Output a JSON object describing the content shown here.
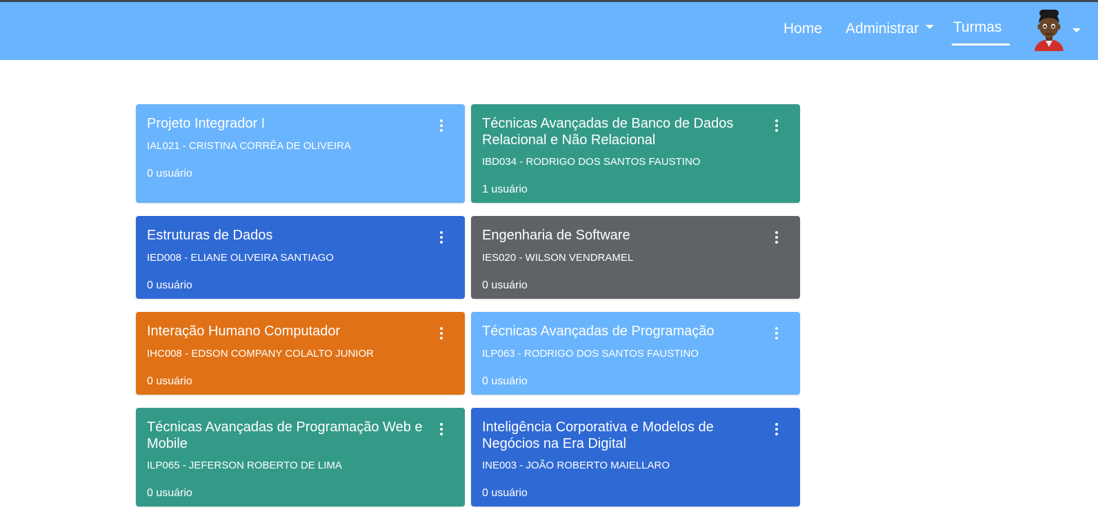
{
  "nav": {
    "home": "Home",
    "admin": "Administrar",
    "turmas": "Turmas"
  },
  "colors": {
    "navbar": "#6ab4fd",
    "light_blue": "#6ab4fd",
    "teal": "#349a88",
    "blue": "#2f69d4",
    "gray": "#5f6368",
    "orange": "#e07116"
  },
  "cards": [
    {
      "title": "Projeto Integrador I",
      "code": "IAL021 - CRISTINA CORRÊA DE OLIVEIRA",
      "users": "0 usuário",
      "color": "#6ab4fd"
    },
    {
      "title": "Técnicas Avançadas de Banco de Dados Relacional e Não Relacional",
      "code": "IBD034 - RODRIGO DOS SANTOS FAUSTINO",
      "users": "1 usuário",
      "color": "#349a88"
    },
    {
      "title": "Estruturas de Dados",
      "code": "IED008 - ELIANE OLIVEIRA SANTIAGO",
      "users": "0 usuário",
      "color": "#2f69d4"
    },
    {
      "title": "Engenharia de Software",
      "code": "IES020 - WILSON VENDRAMEL",
      "users": "0 usuário",
      "color": "#5f6368"
    },
    {
      "title": "Interação Humano Computador",
      "code": "IHC008 - EDSON COMPANY COLALTO JUNIOR",
      "users": "0 usuário",
      "color": "#e07116"
    },
    {
      "title": "Técnicas Avançadas de Programação",
      "code": "ILP063 - RODRIGO DOS SANTOS FAUSTINO",
      "users": "0 usuário",
      "color": "#6ab4fd"
    },
    {
      "title": "Técnicas Avançadas de Programação Web e Mobile",
      "code": "ILP065 - JEFERSON ROBERTO DE LIMA",
      "users": "0 usuário",
      "color": "#349a88"
    },
    {
      "title": "Inteligência Corporativa e Modelos de Negócios na Era Digital",
      "code": "INE003 - JOÃO ROBERTO MAIELLARO",
      "users": "0 usuário",
      "color": "#2f69d4"
    }
  ]
}
